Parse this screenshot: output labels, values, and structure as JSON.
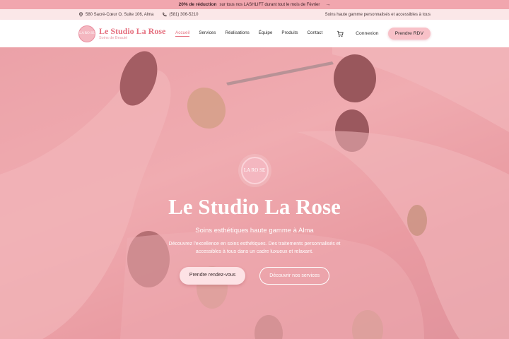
{
  "promo": {
    "bold": "20% de réduction",
    "text": "sur tous nos LASHLIFT durant tout le mois de Février",
    "arrow": "→"
  },
  "infobar": {
    "address": "580 Sacré-Cœur O, Suite 106, Alma",
    "phone": "(581) 306-5210",
    "tagline": "Soins haute gamme personnalisés et accessibles à tous"
  },
  "header": {
    "logo_monogram": "LA RO SE",
    "logo_name": "Le Studio La Rose",
    "logo_sub": "Soins de Beauté",
    "nav": [
      "Accueil",
      "Services",
      "Réalisations",
      "Équipe",
      "Produits",
      "Contact"
    ],
    "login": "Connexion",
    "cta": "Prendre RDV"
  },
  "hero": {
    "badge": "LA RO SE",
    "title": "Le Studio La Rose",
    "subtitle": "Soins esthétiques haute gamme à Alma",
    "description": "Découvrez l'excellence en soins esthétiques. Des traitements personnalisés et accessibles à tous dans un cadre luxueux et relaxant.",
    "primary_button": "Prendre rendez-vous",
    "secondary_button": "Découvrir nos services"
  },
  "colors": {
    "accent": "#e5707f",
    "promo_bg": "#f1a6ae",
    "info_bg": "#fbe7e8",
    "cta_bg": "#f8c1c8"
  }
}
